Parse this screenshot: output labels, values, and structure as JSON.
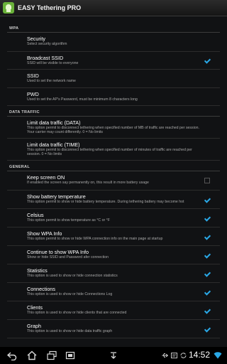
{
  "app": {
    "title": "EASY Tethering PRO",
    "icon": "android-icon"
  },
  "sections": {
    "wpa": "WPA",
    "data_traffic": "DATA TRAFFIC",
    "general": "GENERAL"
  },
  "items": {
    "security": {
      "title": "Security",
      "summary": "Select security algorithm"
    },
    "broadcast_ssid": {
      "title": "Broadcast SSID",
      "summary": "SSID will be visible to everyone",
      "checked": true
    },
    "ssid": {
      "title": "SSID",
      "summary": "Used to set the network name"
    },
    "pwd": {
      "title": "PWD",
      "summary": "Used to set the AP's Password, must be minimum 8 characters long"
    },
    "limit_data": {
      "title": "Limit data traffic (DATA)",
      "summary": "This option permit to disconnect tethering when specified number of MB of traffic are reached per session. Your carrier may count differently. 0 = No limits"
    },
    "limit_time": {
      "title": "Limit data traffic (TIME)",
      "summary": "This option permit to disconnect tethering when specified number of minutes of traffic are reached per session. 0 = No limits"
    },
    "keep_screen": {
      "title": "Keep screen ON",
      "summary": "If enabled the screen say permanently on, this result in more battery usage",
      "checked": false
    },
    "battery_temp": {
      "title": "Show battery temperature",
      "summary": "This option permit to show or hide battery temperature. During tethering battery may become hot",
      "checked": true
    },
    "celsius": {
      "title": "Celsius",
      "summary": "This option permit to show temperature as °C or °F",
      "checked": true
    },
    "wpa_info": {
      "title": "Show WPA Info",
      "summary": "This option permit to show or hide WPA connection info on the main page at startup",
      "checked": true
    },
    "continue_wpa": {
      "title": "Continue to show WPA Info",
      "summary": "Show or hide SSID and Password afer connection",
      "checked": true
    },
    "statistics": {
      "title": "Statistics",
      "summary": "This option is used to show or hide connection statistics",
      "checked": true
    },
    "connections": {
      "title": "Connections",
      "summary": "This option is used to show or hide Connections Log",
      "checked": true
    },
    "clients": {
      "title": "Clients",
      "summary": "This option is used to show or hide clients that are connected",
      "checked": true
    },
    "graph": {
      "title": "Graph",
      "summary": "This option is used to show or hide data traffic graph",
      "checked": true
    }
  },
  "statusbar": {
    "time": "14:52"
  },
  "colors": {
    "accent": "#2aa8e6",
    "background": "#111214"
  }
}
